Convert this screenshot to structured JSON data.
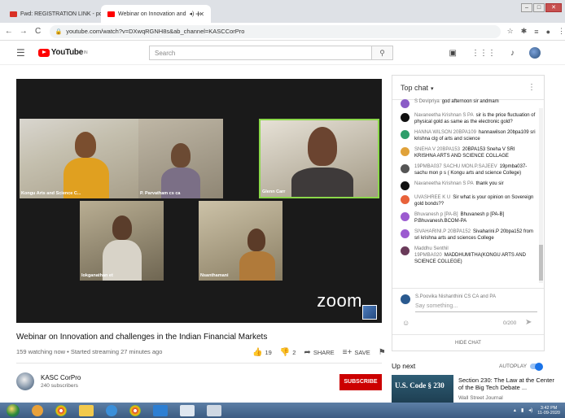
{
  "browser": {
    "tabs": [
      {
        "title": "Fwd: REGISTRATION LINK - poss",
        "favicon_color": "#d93025"
      },
      {
        "title": "Webinar on Innovation and",
        "favicon_color": "#ff0000"
      }
    ],
    "new_tab": "+",
    "window_controls": {
      "minimize": "–",
      "maximize": "□",
      "close": "✕"
    },
    "url": "youtube.com/watch?v=DXwqRGNH8s&ab_channel=KASCCorPro"
  },
  "youtube_header": {
    "logo_text": "YouTube",
    "logo_sup": "IN",
    "search_placeholder": "Search"
  },
  "video": {
    "participants": [
      {
        "name": "Kongu Arts and Science C..."
      },
      {
        "name": "P. Parvatham cs ca"
      },
      {
        "name": "Glenn Carr"
      },
      {
        "name": "lokganathan et"
      },
      {
        "name": "Nsanthamani"
      }
    ],
    "overlay_text": "zoom"
  },
  "below_video": {
    "title": "Webinar on Innovation and challenges in the Indian Financial Markets",
    "meta": "159 watching now • Started streaming 27 minutes ago",
    "likes": "19",
    "dislikes": "2",
    "share": "SHARE",
    "save": "SAVE"
  },
  "channel": {
    "name": "KASC CorPro",
    "subscribers": "240 subscribers",
    "subscribe": "SUBSCRIBE"
  },
  "chat": {
    "header": "Top chat",
    "messages": [
      {
        "author": "S Devipriya",
        "text": "god afternoon sir andmam",
        "color": "#8a5cc7"
      },
      {
        "author": "Navaneetha Krishnan S PA",
        "text": "sir is the price fluctuation of physical gold as same as the electronic gold?",
        "color": "#111111"
      },
      {
        "author": "HANNA WILSON 20BPA109",
        "text": "hannawilson 20bpa109 sri krishna clg of arts and science",
        "color": "#2e9e6a"
      },
      {
        "author": "SNEHA V 20BPA153",
        "text": "20BPA153 Sneha V SRI KRISHNA ARTS AND SCIENCE COLLAGE",
        "color": "#e0a23a"
      },
      {
        "author": "19PMBA037 SACHU MON.P.SAJEEV",
        "text": "19pmba037-sachu mon p s ( Kongu arts and science College)",
        "color": "#555555"
      },
      {
        "author": "Navaneetha Krishnan S PA",
        "text": "thank you sir",
        "color": "#111111"
      },
      {
        "author": "UVASHREE K U",
        "text": "Sir what is your opinion on Sovereign gold bonds??",
        "color": "#e8623a"
      },
      {
        "author": "Bhuvanesh p [PA-B]",
        "text": "Bhuvanesh p [PA-B] P.Bhuvanesh.BCOM-PA",
        "color": "#9c5bd0"
      },
      {
        "author": "SIVAHARINI.P 20BPA152",
        "text": "Sivaharini.P 20bpa152 from sri krishna arts and sciences College",
        "color": "#9c5bd0"
      },
      {
        "author": "Maddhu Senthil 19PMBA020",
        "text": "MADDHUMITHA(KONGU ARTS AND SCIENCE COLLEGE)",
        "color": "#6a3b5a"
      }
    ],
    "compose_name": "S.Poovika Nishanthini CS CA and PA",
    "compose_placeholder": "Say something...",
    "char_count": "0/200",
    "hide_chat": "HIDE CHAT"
  },
  "up_next": {
    "label": "Up next",
    "autoplay": "AUTOPLAY",
    "thumbnail_text": "U.S. Code § 230",
    "title": "Section 230: The Law at the Center of the Big Tech Debate ...",
    "channel": "Wall Street Journal"
  },
  "taskbar": {
    "clock_time": "3:42 PM",
    "clock_date": "11-09-2020"
  }
}
